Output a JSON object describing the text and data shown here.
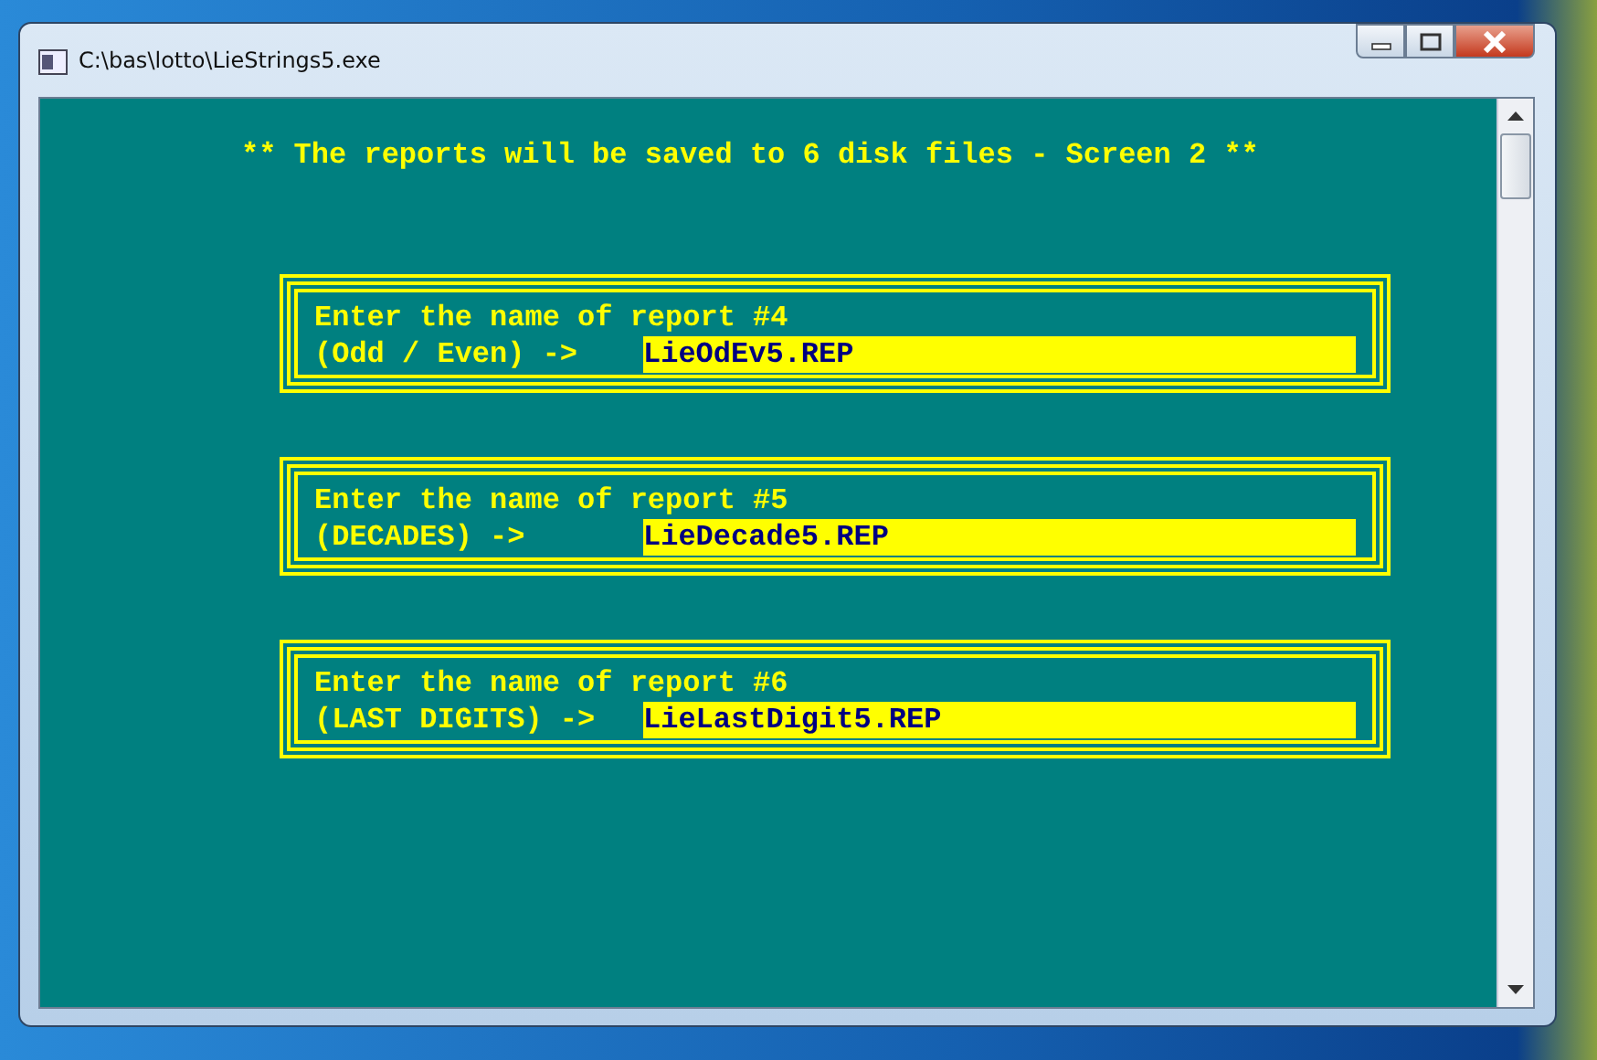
{
  "window": {
    "title": "C:\\bas\\lotto\\LieStrings5.exe"
  },
  "heading": "** The reports will be saved to 6 disk files - Screen 2 **",
  "reports": [
    {
      "prompt": "Enter the name of report #4",
      "label": "(Odd / Even) ->",
      "value": "LieOdEv5.REP"
    },
    {
      "prompt": "Enter the name of report #5",
      "label": "(DECADES) ->",
      "value": "LieDecade5.REP"
    },
    {
      "prompt": "Enter the name of report #6",
      "label": "(LAST DIGITS) ->",
      "value": "LieLastDigit5.REP"
    }
  ]
}
